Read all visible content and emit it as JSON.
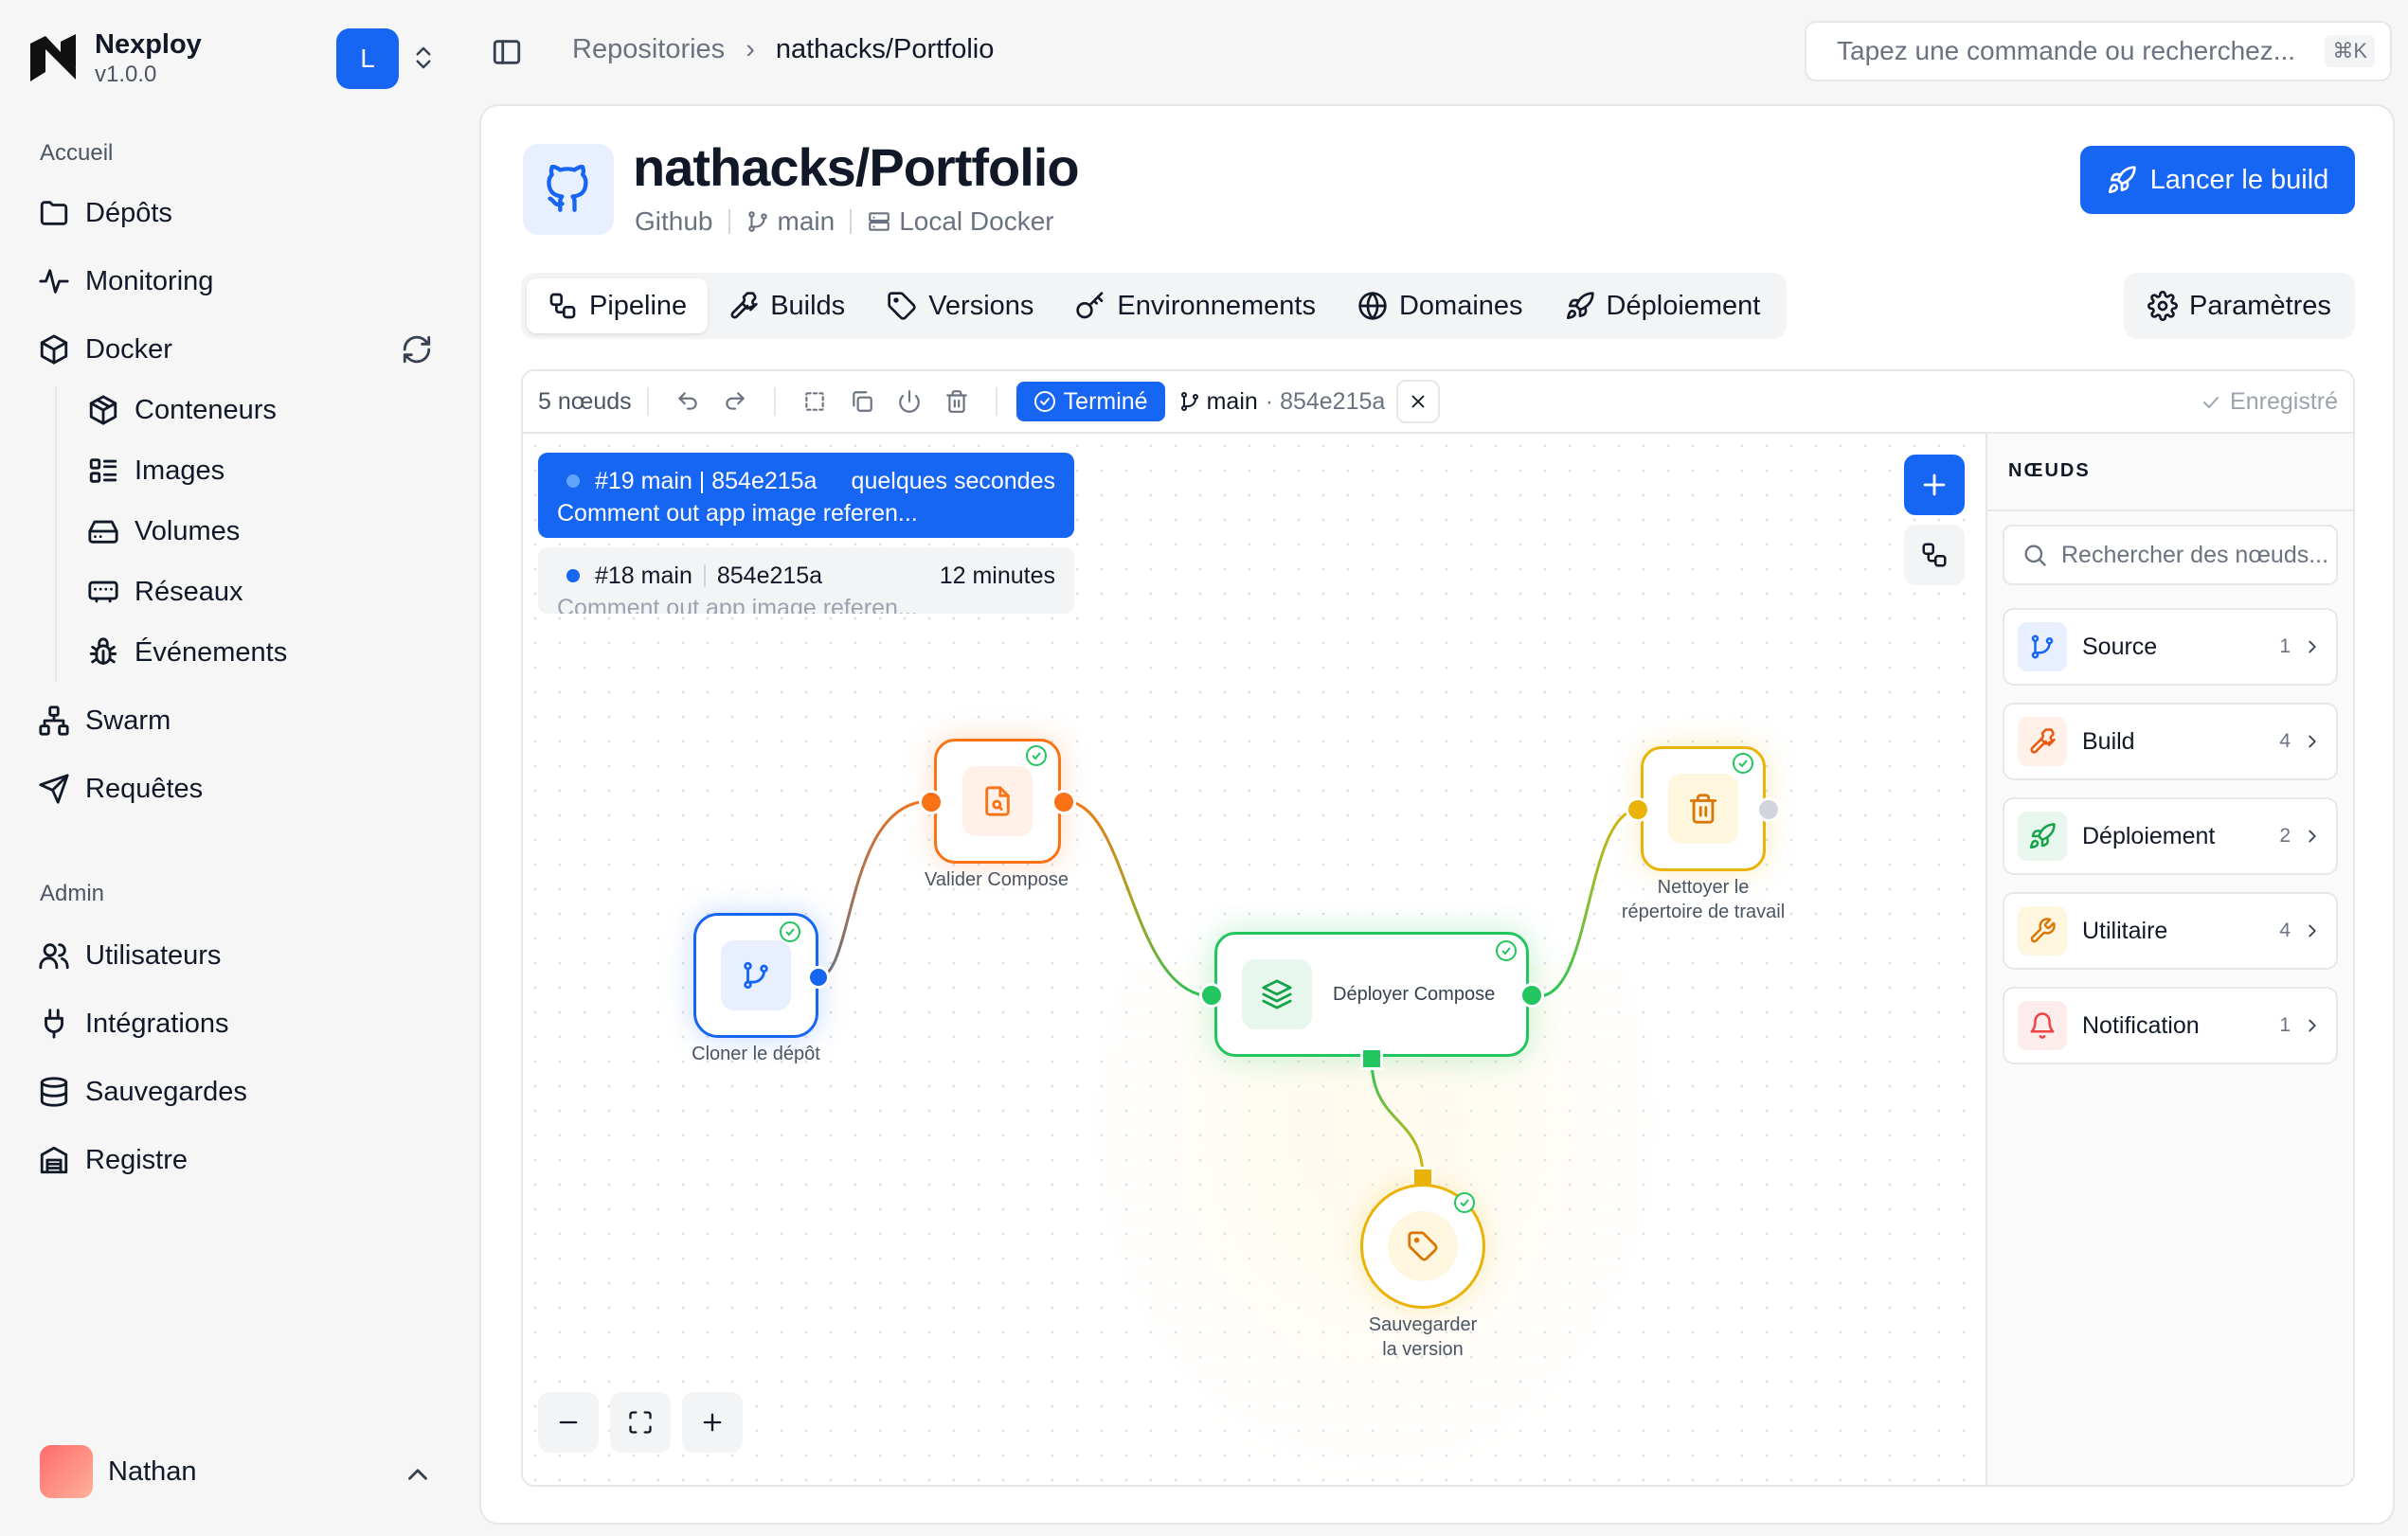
{
  "app": {
    "name": "Nexploy",
    "version": "v1.0.0",
    "workspace_initial": "L"
  },
  "sidebar": {
    "section_home": "Accueil",
    "items": [
      {
        "label": "Dépôts",
        "icon": "folder-icon"
      },
      {
        "label": "Monitoring",
        "icon": "activity-icon"
      },
      {
        "label": "Docker",
        "icon": "box-icon"
      }
    ],
    "docker_sub": [
      {
        "label": "Conteneurs",
        "icon": "package-icon"
      },
      {
        "label": "Images",
        "icon": "list-icon"
      },
      {
        "label": "Volumes",
        "icon": "hard-drive-icon"
      },
      {
        "label": "Réseaux",
        "icon": "network-icon"
      },
      {
        "label": "Événements",
        "icon": "bug-icon"
      }
    ],
    "items_after": [
      {
        "label": "Swarm",
        "icon": "swarm-icon"
      },
      {
        "label": "Requêtes",
        "icon": "send-icon"
      }
    ],
    "section_admin": "Admin",
    "admin_items": [
      {
        "label": "Utilisateurs",
        "icon": "users-icon"
      },
      {
        "label": "Intégrations",
        "icon": "plug-icon"
      },
      {
        "label": "Sauvegardes",
        "icon": "database-icon"
      },
      {
        "label": "Registre",
        "icon": "registry-icon"
      }
    ],
    "user": {
      "name": "Nathan"
    }
  },
  "topbar": {
    "breadcrumb": [
      "Repositories",
      "nathacks/Portfolio"
    ],
    "command_placeholder": "Tapez une commande ou recherchez...",
    "command_shortcut": "⌘K"
  },
  "repo": {
    "title": "nathacks/Portfolio",
    "provider": "Github",
    "branch": "main",
    "server": "Local Docker",
    "launch_label": "Lancer le build"
  },
  "tabs": [
    {
      "label": "Pipeline",
      "icon": "workflow-icon",
      "active": true
    },
    {
      "label": "Builds",
      "icon": "hammer-icon"
    },
    {
      "label": "Versions",
      "icon": "tag-icon"
    },
    {
      "label": "Environnements",
      "icon": "key-icon"
    },
    {
      "label": "Domaines",
      "icon": "globe-icon"
    },
    {
      "label": "Déploiement",
      "icon": "rocket-icon"
    }
  ],
  "settings_label": "Paramètres",
  "toolbar": {
    "node_count": "5 nœuds",
    "status": "Terminé",
    "branch": "main",
    "hash": "854e215a",
    "saved": "Enregistré"
  },
  "commits": [
    {
      "title": "#19 main | 854e215a",
      "time": "quelques secondes",
      "message": "Comment out app image referen..."
    },
    {
      "title": "#18 main",
      "hash": "854e215a",
      "time": "12 minutes",
      "message": "Comment out app image referen..."
    }
  ],
  "nodes": {
    "clone": "Cloner le dépôt",
    "validate": "Valider Compose",
    "deploy": "Déployer Compose",
    "clean_line1": "Nettoyer le",
    "clean_line2": "répertoire de travail",
    "save_line1": "Sauvegarder",
    "save_line2": "la version"
  },
  "panel": {
    "title": "NŒUDS",
    "search_placeholder": "Rechercher des nœuds...",
    "categories": [
      {
        "label": "Source",
        "count": "1",
        "color": "#1766f3",
        "bg": "#e8efff"
      },
      {
        "label": "Build",
        "count": "4",
        "color": "#ea580c",
        "bg": "#fff1e8"
      },
      {
        "label": "Déploiement",
        "count": "2",
        "color": "#16a34a",
        "bg": "#e8f7ee"
      },
      {
        "label": "Utilitaire",
        "count": "4",
        "color": "#d97706",
        "bg": "#fff6e0"
      },
      {
        "label": "Notification",
        "count": "1",
        "color": "#ef4444",
        "bg": "#fdecec"
      }
    ]
  },
  "colors": {
    "accent": "#1766f3",
    "success": "#22c55e",
    "orange": "#f97316",
    "amber": "#eab308"
  }
}
